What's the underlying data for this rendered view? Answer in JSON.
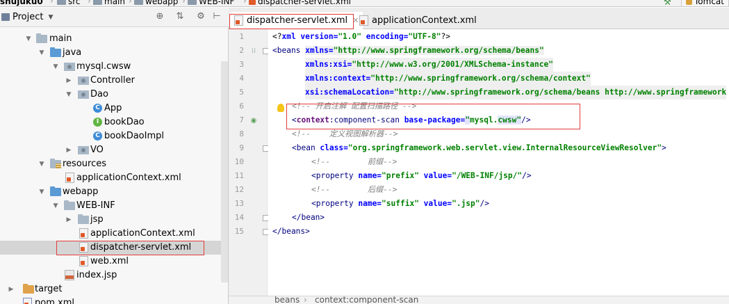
{
  "breadcrumbs": [
    "shujuku0",
    "src",
    "main",
    "webapp",
    "WEB-INF",
    "dispatcher-servlet.xml"
  ],
  "run_config": "Tomcat",
  "project_panel": {
    "title": "Project",
    "tree": [
      {
        "label": "main",
        "icon": "folder-icon"
      },
      {
        "label": "java",
        "icon": "source-folder-icon"
      },
      {
        "label": "mysql.cwsw",
        "icon": "package-icon"
      },
      {
        "label": "Controller",
        "icon": "package-icon"
      },
      {
        "label": "Dao",
        "icon": "package-icon"
      },
      {
        "label": "App",
        "icon": "class-icon"
      },
      {
        "label": "bookDao",
        "icon": "interface-icon"
      },
      {
        "label": "bookDaoImpl",
        "icon": "class-icon"
      },
      {
        "label": "VO",
        "icon": "package-icon"
      },
      {
        "label": "resources",
        "icon": "resources-folder-icon"
      },
      {
        "label": "applicationContext.xml",
        "icon": "xml-file-icon"
      },
      {
        "label": "webapp",
        "icon": "web-folder-icon"
      },
      {
        "label": "WEB-INF",
        "icon": "folder-icon"
      },
      {
        "label": "jsp",
        "icon": "folder-icon"
      },
      {
        "label": "applicationContext.xml",
        "icon": "xml-file-icon"
      },
      {
        "label": "dispatcher-servlet.xml",
        "icon": "xml-file-icon"
      },
      {
        "label": "web.xml",
        "icon": "xml-file-icon"
      },
      {
        "label": "index.jsp",
        "icon": "jsp-file-icon"
      },
      {
        "label": "target",
        "icon": "excluded-folder-icon"
      },
      {
        "label": "pom.xml",
        "icon": "maven-file-icon"
      }
    ]
  },
  "editor": {
    "tabs": [
      {
        "label": "dispatcher-servlet.xml",
        "active": true
      },
      {
        "label": "applicationContext.xml",
        "active": false
      }
    ],
    "line_numbers": [
      "1",
      "2",
      "3",
      "4",
      "5",
      "6",
      "7",
      "8",
      "9",
      "10",
      "11",
      "12",
      "13",
      "14",
      "15"
    ],
    "code": {
      "l1_a": "<?",
      "l1_b": "xml version=",
      "l1_c": "\"1.0\"",
      "l1_d": " encoding=",
      "l1_e": "\"UTF-8\"",
      "l1_f": "?>",
      "l2_tag": "<beans ",
      "l2_attr": "xmlns=",
      "l2_val": "\"http://www.springframework.org/schema/beans\"",
      "l3_attr": "xmlns:xsi=",
      "l3_val": "\"http://www.w3.org/2001/XMLSchema-instance\"",
      "l4_attr": "xmlns:context=",
      "l4_val": "\"http://www.springframework.org/schema/context\"",
      "l5_attr": "xsi:schemaLocation=",
      "l5_val": "\"http://www.springframework.org/schema/beans http://www.springframework",
      "l6_cmt": "<!-- 开启注解 配置扫描路径 -->",
      "l7_tag1": "<",
      "l7_ns": "context",
      "l7_tag2": ":component-scan ",
      "l7_attr": "base-package=",
      "l7_q1": "\"",
      "l7_v1": "mysql.",
      "l7_v2": "cwsw",
      "l7_q2": "\"",
      "l7_end": "/>",
      "l8_cmt": "<!--    定义视图解析器-->",
      "l9_tag": "<bean ",
      "l9_attr": "class=",
      "l9_val": "\"org.springframework.web.servlet.view.InternalResourceViewResolver\"",
      "l9_end": ">",
      "l10_cmt": "<!--        前缀-->",
      "l11_tag": "<property ",
      "l11_attr1": "name=",
      "l11_val1": "\"prefix\"",
      "l11_attr2": " value=",
      "l11_val2": "\"/WEB-INF/jsp/\"",
      "l11_end": "/>",
      "l12_cmt": "<!--        后缀-->",
      "l13_tag": "<property ",
      "l13_attr1": "name=",
      "l13_val1": "\"suffix\"",
      "l13_attr2": " value=",
      "l13_val2": "\".jsp\"",
      "l13_end": "/>",
      "l14": "</bean>",
      "l15": "</beans>"
    },
    "status_path": [
      "beans",
      "context:component-scan"
    ]
  },
  "colors": {
    "highlight_box": "#e23b3b",
    "xml_tag": "#000080",
    "xml_attr": "#0000ff",
    "xml_value": "#008000",
    "comment": "#808080"
  }
}
